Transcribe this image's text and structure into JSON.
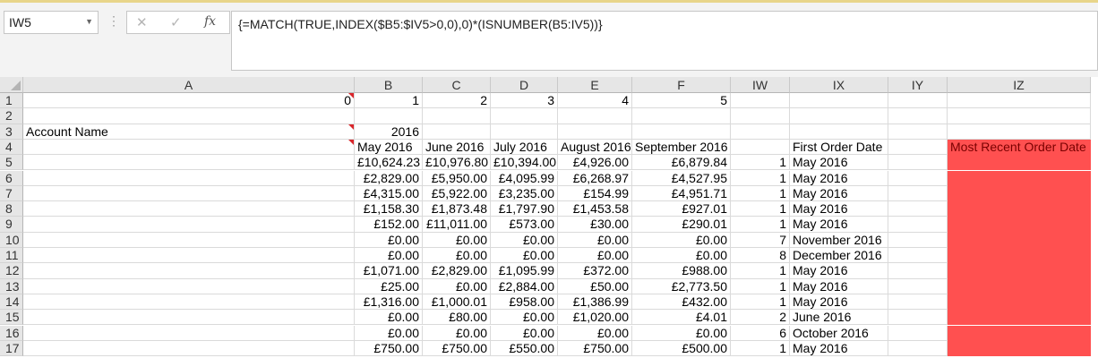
{
  "formula_bar": {
    "name_box": "IW5",
    "cancel_glyph": "✕",
    "enter_glyph": "✓",
    "fx_glyph": "fx",
    "formula": "{=MATCH(TRUE,INDEX($B5:$IV5>0,0),0)*(ISNUMBER(B5:IV5))}"
  },
  "columns": [
    "A",
    "B",
    "C",
    "D",
    "E",
    "F",
    "IW",
    "IX",
    "IY",
    "IZ"
  ],
  "row_numbers": [
    "1",
    "2",
    "3",
    "4",
    "5",
    "6",
    "7",
    "8",
    "9",
    "10",
    "11",
    "12",
    "13",
    "14",
    "15",
    "16",
    "17"
  ],
  "rows": [
    [
      "0",
      "1",
      "2",
      "3",
      "4",
      "5",
      "",
      "",
      "",
      ""
    ],
    [
      "",
      "",
      "",
      "",
      "",
      "",
      "",
      "",
      "",
      ""
    ],
    [
      "Account Name",
      "2016",
      "",
      "",
      "",
      "",
      "",
      "",
      "",
      ""
    ],
    [
      "",
      "May 2016",
      "June 2016",
      "July 2016",
      "August 2016",
      "September 2016",
      "",
      "First Order Date",
      "",
      "Most Recent Order Date"
    ],
    [
      "",
      "£10,624.23",
      "£10,976.80",
      "£10,394.00",
      "£4,926.00",
      "£6,879.84",
      "1",
      "May 2016",
      "",
      ""
    ],
    [
      "",
      "£2,829.00",
      "£5,950.00",
      "£4,095.99",
      "£6,268.97",
      "£4,527.95",
      "1",
      "May 2016",
      "",
      ""
    ],
    [
      "",
      "£4,315.00",
      "£5,922.00",
      "£3,235.00",
      "£154.99",
      "£4,951.71",
      "1",
      "May 2016",
      "",
      ""
    ],
    [
      "",
      "£1,158.30",
      "£1,873.48",
      "£1,797.90",
      "£1,453.58",
      "£927.01",
      "1",
      "May 2016",
      "",
      ""
    ],
    [
      "",
      "£152.00",
      "£11,011.00",
      "£573.00",
      "£30.00",
      "£290.01",
      "1",
      "May 2016",
      "",
      ""
    ],
    [
      "",
      "£0.00",
      "£0.00",
      "£0.00",
      "£0.00",
      "£0.00",
      "7",
      "November 2016",
      "",
      ""
    ],
    [
      "",
      "£0.00",
      "£0.00",
      "£0.00",
      "£0.00",
      "£0.00",
      "8",
      "December 2016",
      "",
      ""
    ],
    [
      "",
      "£1,071.00",
      "£2,829.00",
      "£1,095.99",
      "£372.00",
      "£988.00",
      "1",
      "May 2016",
      "",
      ""
    ],
    [
      "",
      "£25.00",
      "£0.00",
      "£2,884.00",
      "£50.00",
      "£2,773.50",
      "1",
      "May 2016",
      "",
      ""
    ],
    [
      "",
      "£1,316.00",
      "£1,000.01",
      "£958.00",
      "£1,386.99",
      "£432.00",
      "1",
      "May 2016",
      "",
      ""
    ],
    [
      "",
      "£0.00",
      "£80.00",
      "£0.00",
      "£1,020.00",
      "£4.01",
      "2",
      "June 2016",
      "",
      ""
    ],
    [
      "",
      "£0.00",
      "£0.00",
      "£0.00",
      "£0.00",
      "£0.00",
      "6",
      "October 2016",
      "",
      ""
    ],
    [
      "",
      "£750.00",
      "£750.00",
      "£550.00",
      "£750.00",
      "£500.00",
      "1",
      "May 2016",
      "",
      ""
    ]
  ],
  "colors": {
    "highlight_fill": "#ff5050",
    "comment_indicator": "#d9262b",
    "header_fill": "#e6e6e6"
  }
}
